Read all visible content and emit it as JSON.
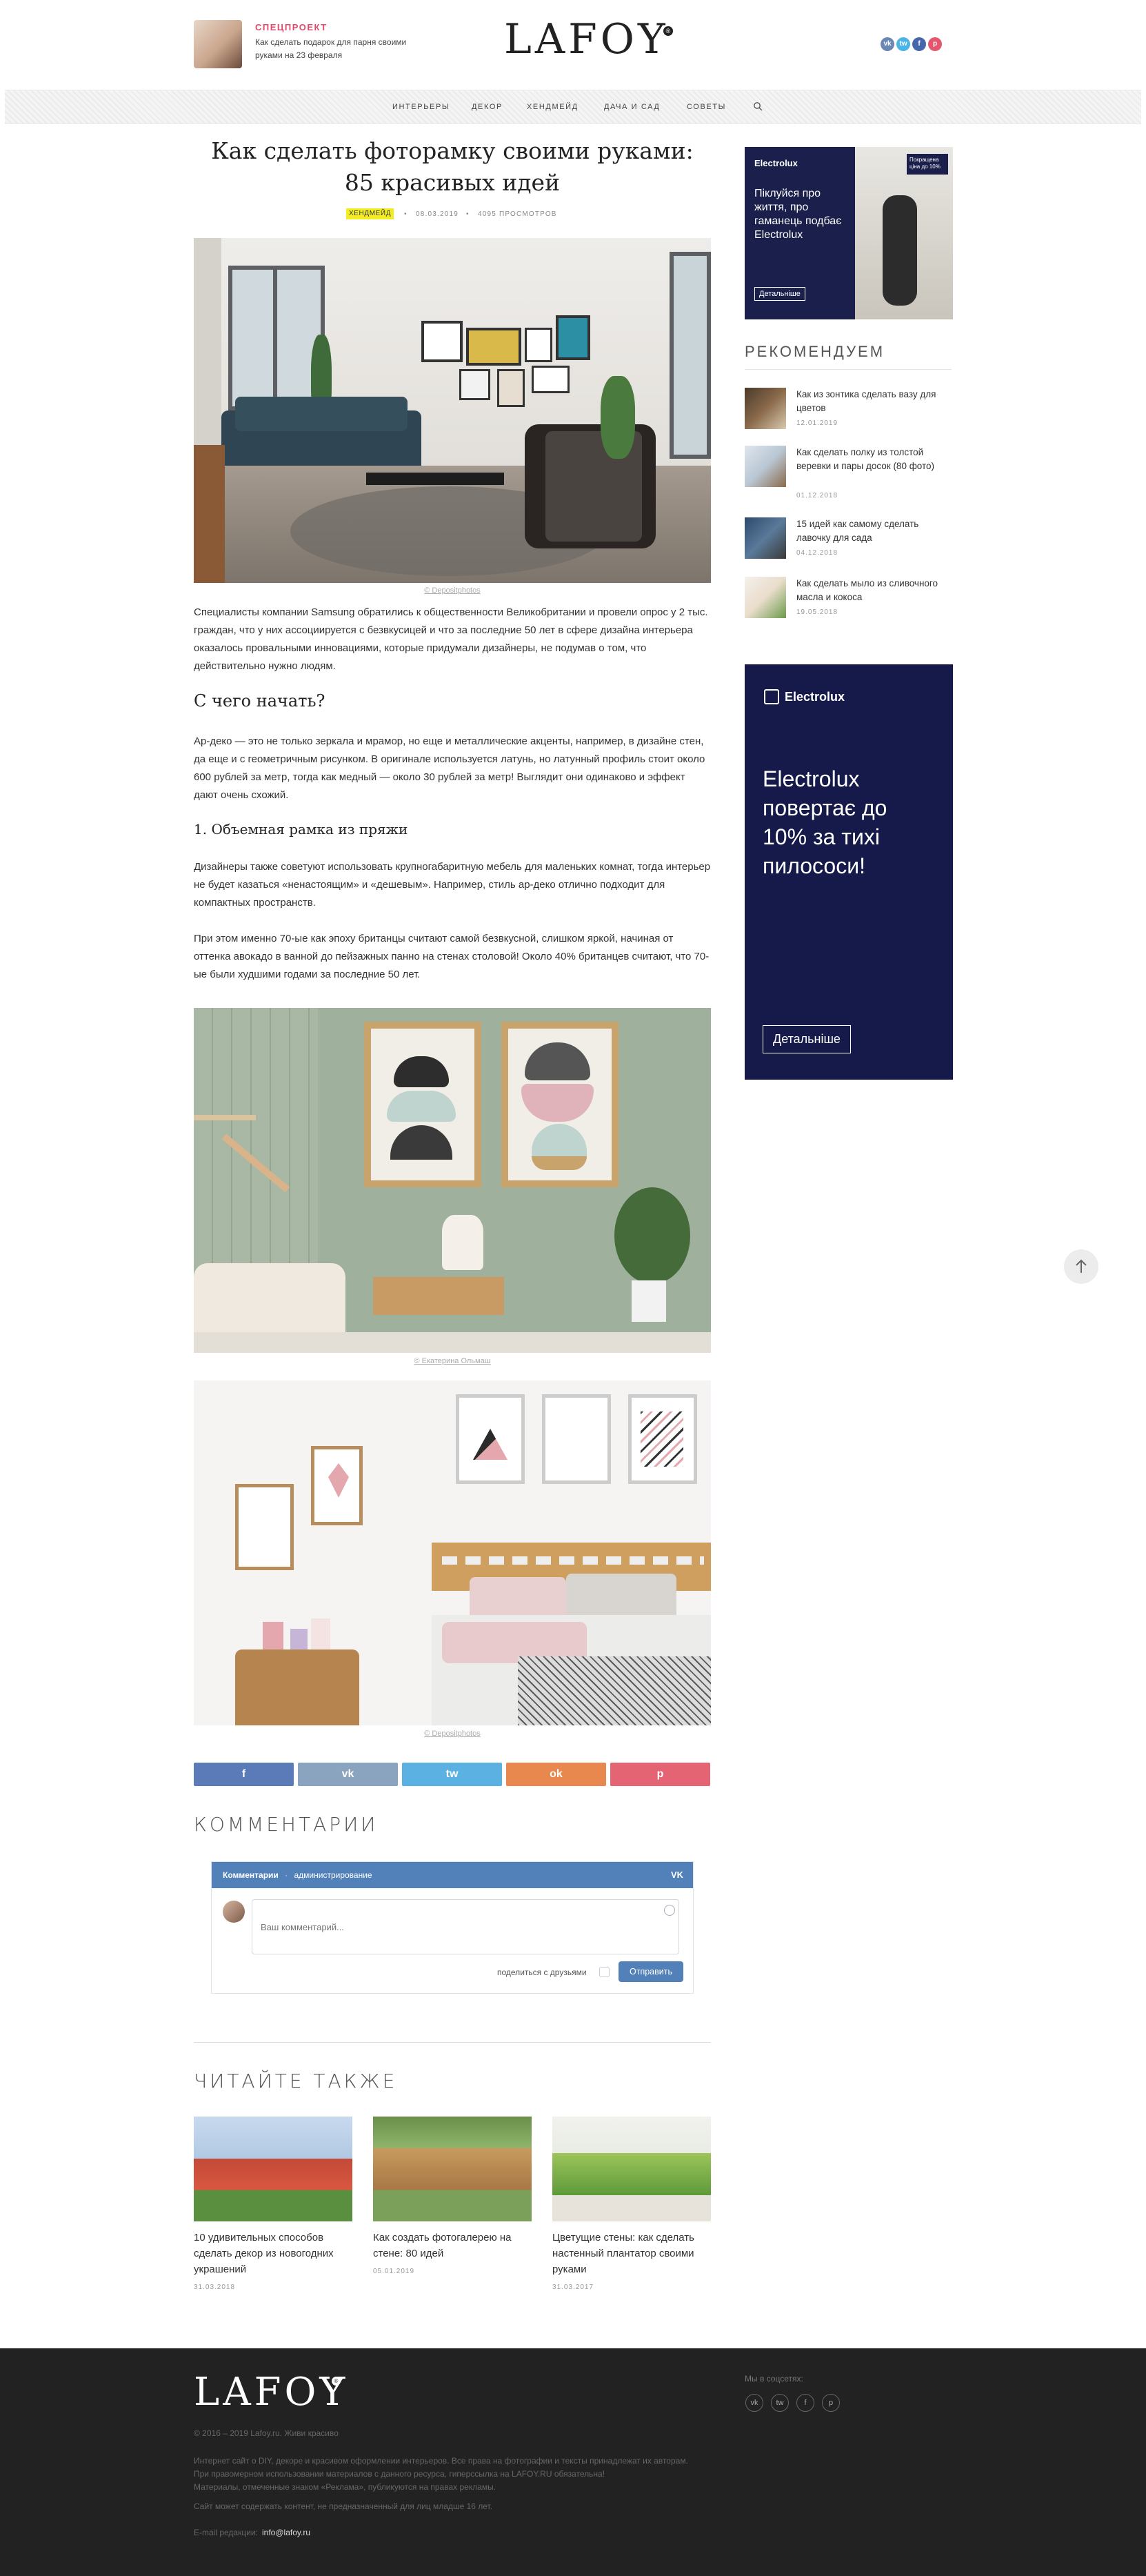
{
  "header": {
    "promo_tag": "СПЕЦПРОЕКТ",
    "promo_text": "Как сделать подарок для парня своими руками на 23 февраля",
    "logo": "LAFOY",
    "logo_mark": "®",
    "social": [
      "vk",
      "tw",
      "f",
      "p"
    ]
  },
  "nav": {
    "items": [
      "ИНТЕРЬЕРЫ",
      "ДЕКОР",
      "ХЕНДМЕЙД",
      "ДАЧА И САД",
      "СОВЕТЫ"
    ]
  },
  "article": {
    "title": "Как сделать фоторамку своими руками: 85 красивых идей",
    "category": "ХЕНДМЕЙД",
    "date": "08.03.2019",
    "views": "4095 ПРОСМОТРОВ",
    "caption1": "© Depositphotos",
    "para1": "Специалисты компании Samsung обратились к общественности Великобритании и провели опрос у 2 тыс. граждан, что у них ассоциируется с безвкусицей и что за последние 50 лет в сфере дизайна интерьера оказалось провальными инновациями, которые придумали дизайнеры, не подумав о том, что действительно нужно людям.",
    "h2": "С чего начать?",
    "para2": "Ар-деко — это не только зеркала и мрамор, но еще и металлические акценты, например, в дизайне стен, да еще и с геометричным рисунком. В оригинале используется латунь, но латунный профиль стоит около 600 рублей за метр, тогда как медный — около 30 рублей за метр! Выглядит они одинаково и эффект дают очень схожий.",
    "h3": "1. Объемная рамка из пряжи",
    "para3": "Дизайнеры также советуют использовать крупногабаритную мебель для маленьких комнат, тогда интерьер не будет казаться «ненастоящим» и «дешевым». Например, стиль ар-деко отлично подходит для компактных пространств.",
    "para4": "При этом именно 70-ые как эпоху британцы считают самой безвкусной, слишком яркой, начиная от оттенка авокадо в ванной до пейзажных панно на стенах столовой! Около 40% британцев считают, что 70-ые были худшими годами за последние 50 лет.",
    "caption2": "© Екатерина Ольмаш",
    "caption3": "© Depositphotos"
  },
  "share": {
    "labels": [
      "f",
      "vk",
      "tw",
      "ok",
      "p"
    ],
    "colors": [
      "#5a7ab8",
      "#8aa3bf",
      "#5cb1e3",
      "#e8884e",
      "#e56474"
    ]
  },
  "comments": {
    "heading": "КОММЕНТАРИИ",
    "bar_title": "Комментарии",
    "bar_sep": "·",
    "bar_admin": "администрирование",
    "bar_logo": "VK",
    "placeholder": "Ваш комментарий...",
    "share_friends": "поделиться с друзьями",
    "submit": "Отправить"
  },
  "sidebar": {
    "ad1": {
      "brand": "Electrolux",
      "text": "Піклуйся про життя, про гаманець подбає Electrolux",
      "button": "Детальніше",
      "badge": "Покращена ціна до 10%"
    },
    "rec_heading": "РЕКОМЕНДУЕМ",
    "recommended": [
      {
        "title": "Как из зонтика сделать вазу для цветов",
        "date": "12.01.2019"
      },
      {
        "title": "Как сделать полку из толстой веревки и пары досок (80 фото)",
        "date": "01.12.2018"
      },
      {
        "title": "15 идей как самому сделать лавочку для сада",
        "date": "04.12.2018"
      },
      {
        "title": "Как сделать мыло из сливочного масла и кокоса",
        "date": "19.05.2018"
      }
    ],
    "ad2": {
      "brand": "Electrolux",
      "text": "Electrolux повертає до 10% за тихі пилососи!",
      "button": "Детальніше"
    }
  },
  "read_also": {
    "heading": "ЧИТАЙТЕ ТАКЖЕ",
    "items": [
      {
        "title": "10 удивительных способов сделать декор из новогодних украшений",
        "date": "31.03.2018"
      },
      {
        "title": "Как создать фотогалерею на стене: 80 идей",
        "date": "05.01.2019"
      },
      {
        "title": "Цветущие стены: как сделать настенный плантатор своими руками",
        "date": "31.03.2017"
      }
    ]
  },
  "footer": {
    "logo": "LAFOY",
    "logo_mark": "®",
    "copyright": "© 2016 – 2019 Lafoy.ru. Живи красиво",
    "text1": "Интернет сайт о DIY, декоре и красивом оформлении интерьеров. Все права на фотографии и тексты принадлежат их авторам.",
    "text2": "При правомерном использовании материалов с данного ресурса, гиперссылка на LAFOY.RU обязательна!",
    "text3": "Материалы, отмеченные знаком «Реклама», публикуются на правах рекламы.",
    "text4": "Сайт может содержать контент, не предназначенный для лиц младше 16 лет.",
    "email_label": "E-mail редакции:",
    "email": "info@lafoy.ru",
    "social_label": "Мы в соцсетях:",
    "social": [
      "vk",
      "tw",
      "f",
      "p"
    ]
  }
}
